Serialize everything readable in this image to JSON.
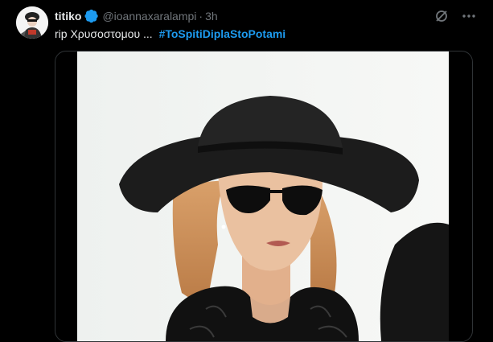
{
  "post": {
    "display_name": "titiko",
    "handle": "@ioannaxaralampi",
    "separator": "·",
    "time": "3h",
    "text": "rip  Χρυσοστομου ...",
    "hashtag": "#ToSpitiDiplaStoPotami"
  },
  "colors": {
    "background": "#000000",
    "text": "#e7e9ea",
    "secondary": "#71767b",
    "accent": "#1d9bf0"
  },
  "icons": [
    "verified-badge-icon",
    "grok-icon",
    "more-icon"
  ]
}
